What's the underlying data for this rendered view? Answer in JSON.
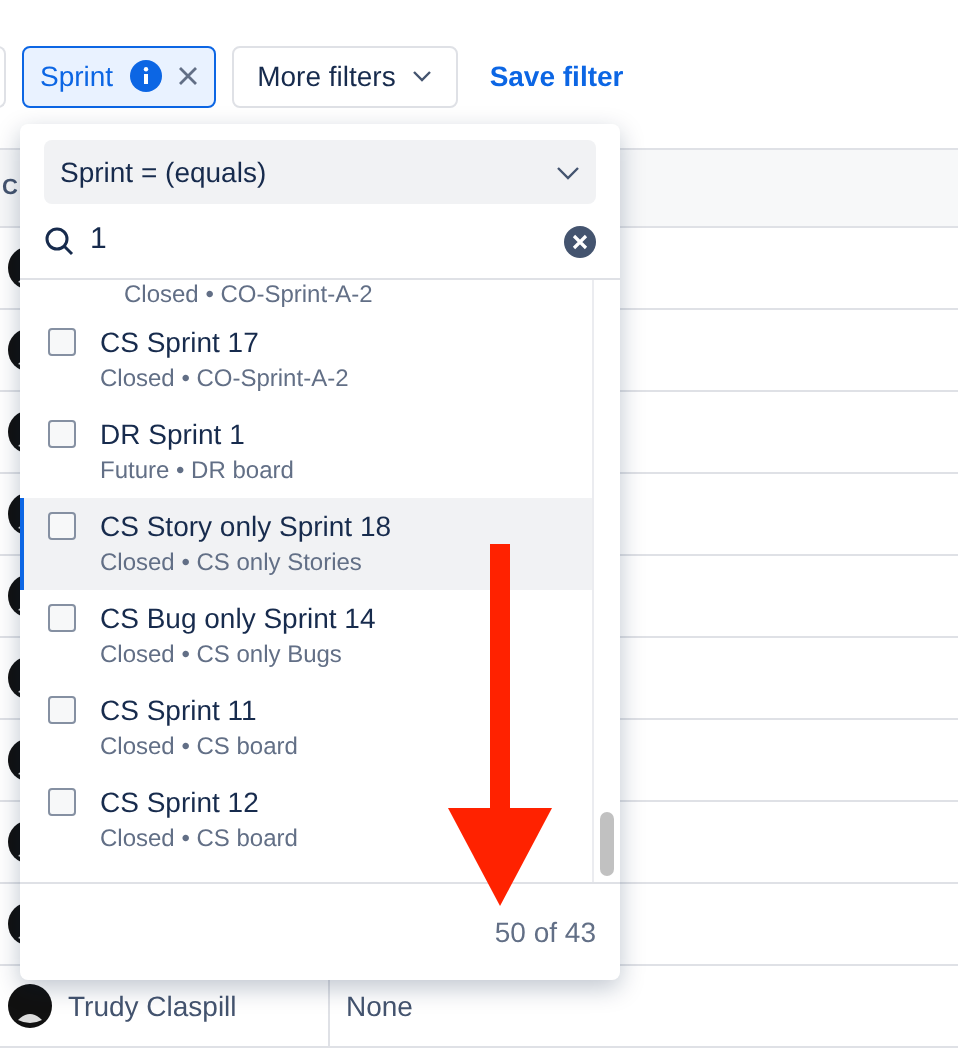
{
  "filter_bar": {
    "sprint_chip": {
      "label": "Sprint",
      "selected": true
    },
    "more_filters": {
      "label": "More filters"
    },
    "save_filter": {
      "label": "Save filter"
    }
  },
  "table": {
    "header": "C",
    "rows": [
      {
        "name": "Trudy Claspill",
        "column_2": "None"
      }
    ]
  },
  "dropdown": {
    "operator": "Sprint = (equals)",
    "search": {
      "value": "1"
    },
    "items": [
      {
        "subtitle": "Closed • CO-Sprint-A-2",
        "highlighted": false
      },
      {
        "title": "CS Sprint 17",
        "subtitle": "Closed • CO-Sprint-A-2",
        "checked": false,
        "highlighted": false
      },
      {
        "title": "DR Sprint 1",
        "subtitle": "Future • DR board",
        "checked": false,
        "highlighted": false
      },
      {
        "title": "CS Story only Sprint 18",
        "subtitle": "Closed • CS only Stories",
        "checked": false,
        "highlighted": true
      },
      {
        "title": "CS Bug only Sprint 14",
        "subtitle": "Closed • CS only Bugs",
        "checked": false,
        "highlighted": false
      },
      {
        "title": "CS Sprint 11",
        "subtitle": "Closed • CS board",
        "checked": false,
        "highlighted": false
      },
      {
        "title": "CS Sprint 12",
        "subtitle": "Closed • CS board",
        "checked": false,
        "highlighted": false
      }
    ],
    "count": "50 of 43"
  }
}
